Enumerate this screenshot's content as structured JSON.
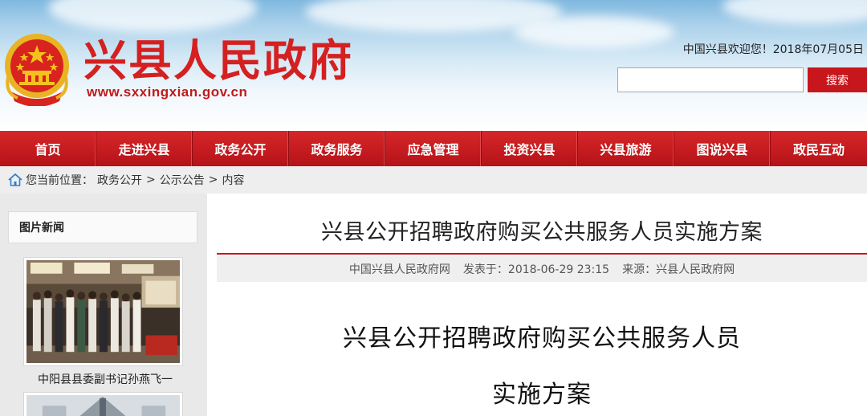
{
  "header": {
    "site_title": "兴县人民政府",
    "site_url": "www.sxxingxian.gov.cn",
    "welcome": "中国兴县欢迎您！2018年07月05日",
    "search_placeholder": "",
    "search_label": "搜索"
  },
  "nav": [
    {
      "label": "首页"
    },
    {
      "label": "走进兴县"
    },
    {
      "label": "政务公开"
    },
    {
      "label": "政务服务"
    },
    {
      "label": "应急管理"
    },
    {
      "label": "投资兴县"
    },
    {
      "label": "兴县旅游"
    },
    {
      "label": "图说兴县"
    },
    {
      "label": "政民互动"
    }
  ],
  "breadcrumb": {
    "prefix": "您当前位置：",
    "items": [
      "政务公开",
      "公示公告",
      "内容"
    ],
    "separator": ">"
  },
  "sidebar": {
    "section_title": "图片新闻",
    "items": [
      {
        "caption": "中阳县县委副书记孙燕飞一"
      }
    ]
  },
  "article": {
    "title": "兴县公开招聘政府购买公共服务人员实施方案",
    "source_site": "中国兴县人民政府网",
    "published": "发表于：2018-06-29 23:15",
    "source": "来源：兴县人民政府网",
    "body_title_line1": "兴县公开招聘政府购买公共服务人员",
    "body_title_line2": "实施方案"
  },
  "colors": {
    "brand_red": "#c8161d",
    "nav_red": "#c41c21",
    "title_red": "#d42020"
  }
}
